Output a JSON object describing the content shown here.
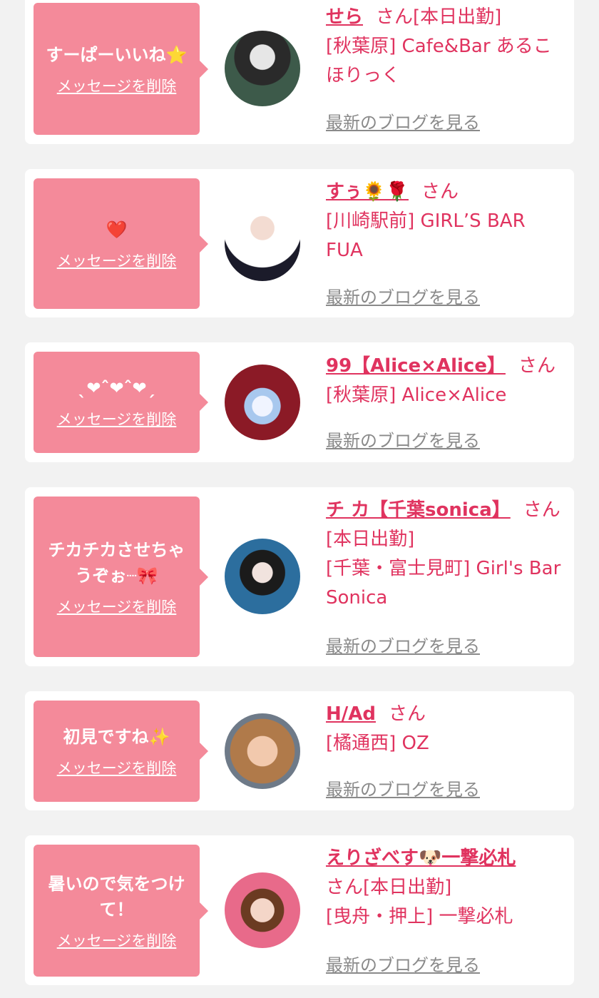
{
  "colors": {
    "page_bg": "#f2f2f2",
    "card_bg": "#ffffff",
    "bubble_bg": "#f48a9a",
    "accent": "#e0335f",
    "blog_link": "#8a8a8a"
  },
  "delete_label": "メッセージを削除",
  "blog_label": "最新のブログを見る",
  "san_label": "さん",
  "entries": [
    {
      "message": "すーぱーいいね⭐",
      "name": "せら",
      "status": "[本日出勤]",
      "store": "[秋葉原] Cafe&Bar あるこほりっく"
    },
    {
      "message": "❤️",
      "name": "すぅ🌻🌹",
      "status": "",
      "store": "[川崎駅前] GIRL’S BAR FUA"
    },
    {
      "message": "ˎ❤︎ˆ❤︎ˆ❤︎ˏ",
      "name": "99【Alice×Alice】",
      "status": "",
      "store": "[秋葉原] Alice×Alice"
    },
    {
      "message": "チカチカさせちゃうぞぉ┈🎀",
      "name": "チ カ【千葉sonica】",
      "status": "[本日出勤]",
      "store": "[千葉・富士見町] Girl's Bar Sonica"
    },
    {
      "message": "初見ですね✨",
      "name": "H/Ad",
      "status": "",
      "store": "[橘通西] OZ"
    },
    {
      "message": "暑いので気をつけて！",
      "name": "えりざべす🐶一撃必札",
      "status": "[本日出勤]",
      "store": "[曳舟・押上] 一撃必札"
    }
  ]
}
